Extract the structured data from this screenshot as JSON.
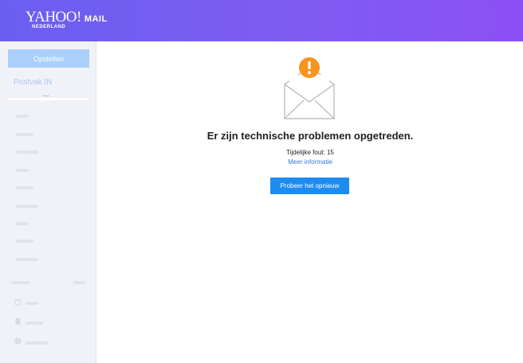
{
  "header": {
    "logo_text": "YAHOO!",
    "logo_product": "MAIL",
    "logo_region": "NEDERLAND",
    "background_start": "#6a5ef0",
    "background_end": "#8c4ff5"
  },
  "sidebar": {
    "compose_label": "Opstellen",
    "inbox_label": "Postvak IN",
    "more_label": "...",
    "placeholder_icons": [
      "calendar-icon",
      "document-icon",
      "help-icon"
    ]
  },
  "error": {
    "icon": "envelope-alert-icon",
    "title": "Er zijn technische problemen opgetreden.",
    "code_text": "Tijdelijke fout: 15",
    "more_info_label": "Meer informatie",
    "retry_label": "Probeer het opnieuw",
    "accent_color": "#1d8cf0",
    "alert_color": "#f7941d"
  }
}
